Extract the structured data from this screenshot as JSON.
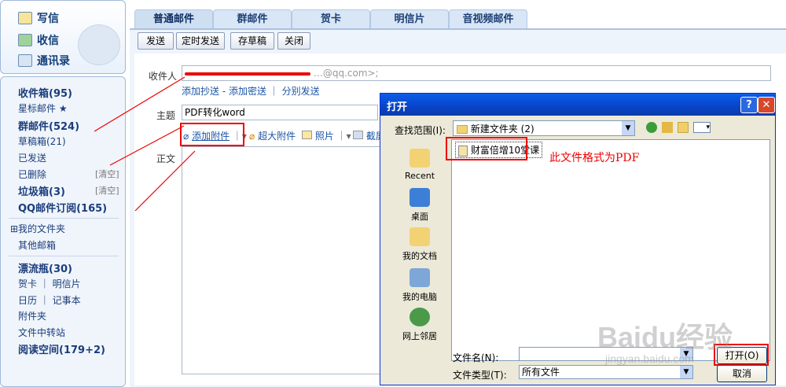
{
  "sidebar": {
    "top": {
      "compose": "写信",
      "inbox": "收信",
      "contacts": "通讯录"
    },
    "folders": [
      {
        "label": "收件箱(95)",
        "bold": true
      },
      {
        "label": "星标邮件 ★",
        "bold": false
      },
      {
        "label": "群邮件(524)",
        "bold": true
      },
      {
        "label": "草稿箱(21)",
        "bold": false
      },
      {
        "label": "已发送",
        "bold": false
      },
      {
        "label": "已删除",
        "bold": false
      },
      {
        "label": "垃圾箱(3)",
        "bold": true
      },
      {
        "label": "QQ邮件订阅(165)",
        "bold": true
      }
    ],
    "clear_label": "[清空]",
    "my_folders": "⊞我的文件夹",
    "other_mailbox": "其他邮箱",
    "drift_bottle": "漂流瓶(30)",
    "cards": "贺卡 ｜ 明信片",
    "calendar": "日历 ｜ 记事本",
    "attachments": "附件夹",
    "transfer": "文件中转站",
    "reading": "阅读空间(179+2)"
  },
  "tabs": [
    "普通邮件",
    "群邮件",
    "贺卡",
    "明信片",
    "音视频邮件"
  ],
  "toolbar": {
    "send": "发送",
    "scheduled": "定时发送",
    "save": "存草稿",
    "close": "关闭"
  },
  "compose": {
    "to_label": "收件人",
    "to_value": "…@qq.com>;",
    "add_cc": "添加抄送 - 添加密送 ｜ 分别发送",
    "subject_label": "主题",
    "subject_value": "PDF转化word",
    "add_attachment": "添加附件",
    "large_attachment": "超大附件",
    "photo": "照片",
    "screenshot": "截屏",
    "body_label": "正文"
  },
  "dialog": {
    "title": "打开",
    "help": "?",
    "close": "✕",
    "look_in_label": "查找范围(I):",
    "look_in_value": "新建文件夹 (2)",
    "places": [
      "Recent",
      "桌面",
      "我的文档",
      "我的电脑",
      "网上邻居"
    ],
    "file_item": "财富倍增10堂课",
    "filename_label": "文件名(N):",
    "filetype_label": "文件类型(T):",
    "filetype_value": "所有文件",
    "open": "打开(O)",
    "cancel": "取消"
  },
  "annotation": "此文件格式为PDF",
  "watermark": {
    "brand": "Baidu经验",
    "url": "jingyan.baidu.com"
  }
}
